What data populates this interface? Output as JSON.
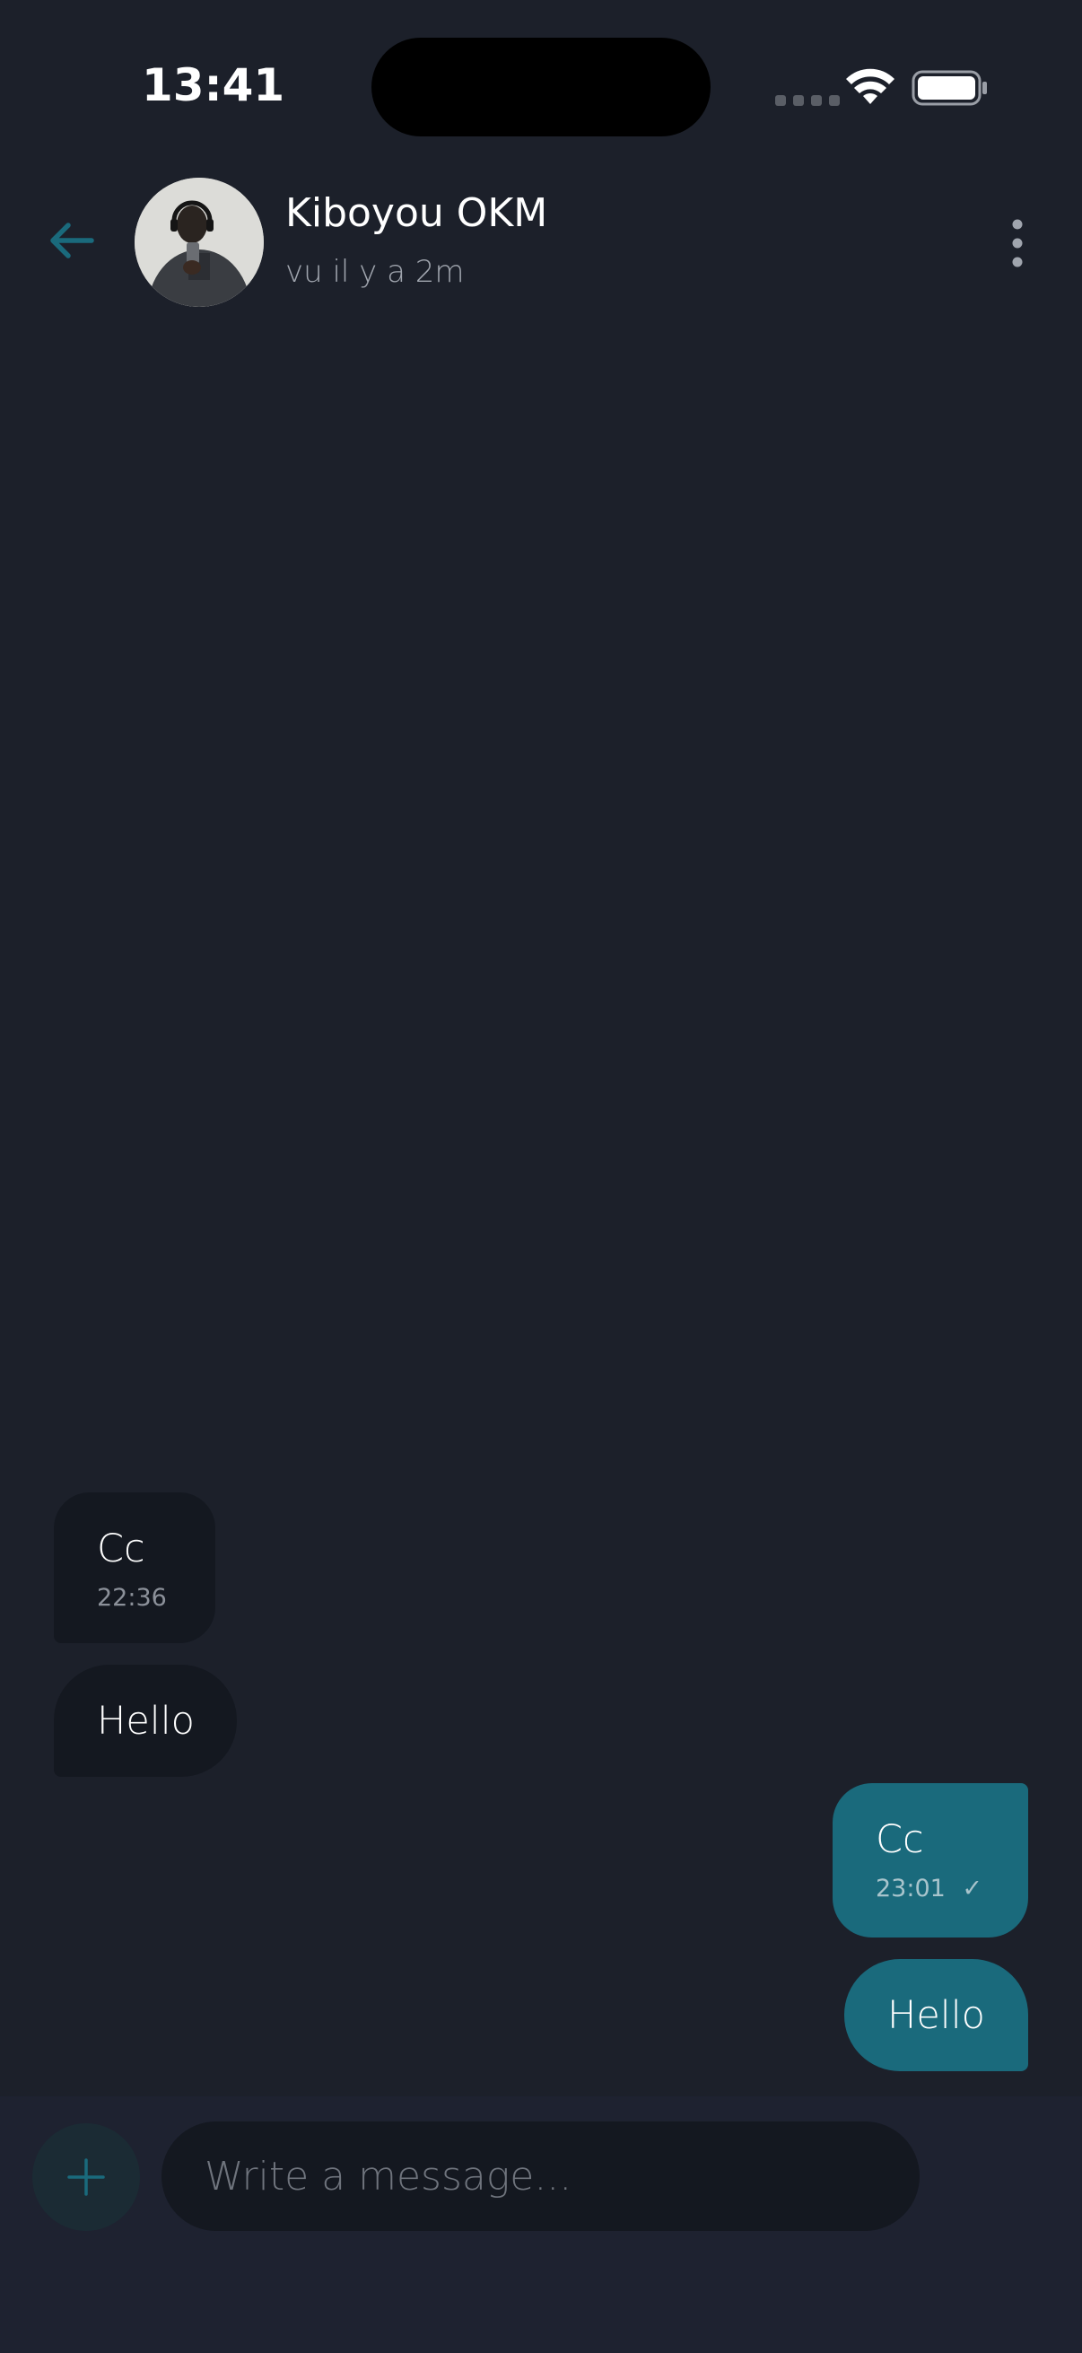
{
  "status_bar": {
    "time": "13:41"
  },
  "header": {
    "contact_name": "Kiboyou OKM",
    "contact_status": "vu il y a 2m",
    "back_icon": "arrow-left-icon",
    "more_icon": "more-vertical-icon",
    "accent_color": "#1a6a7c"
  },
  "messages": [
    {
      "direction": "in",
      "text": "Cc",
      "time": "22:36"
    },
    {
      "direction": "in",
      "text": "Hello"
    },
    {
      "direction": "out",
      "text": "Cc",
      "time": "23:01",
      "read_mark": "✓"
    },
    {
      "direction": "out",
      "text": "Hello"
    }
  ],
  "composer": {
    "placeholder": "Write a message...",
    "add_icon": "plus-icon"
  }
}
